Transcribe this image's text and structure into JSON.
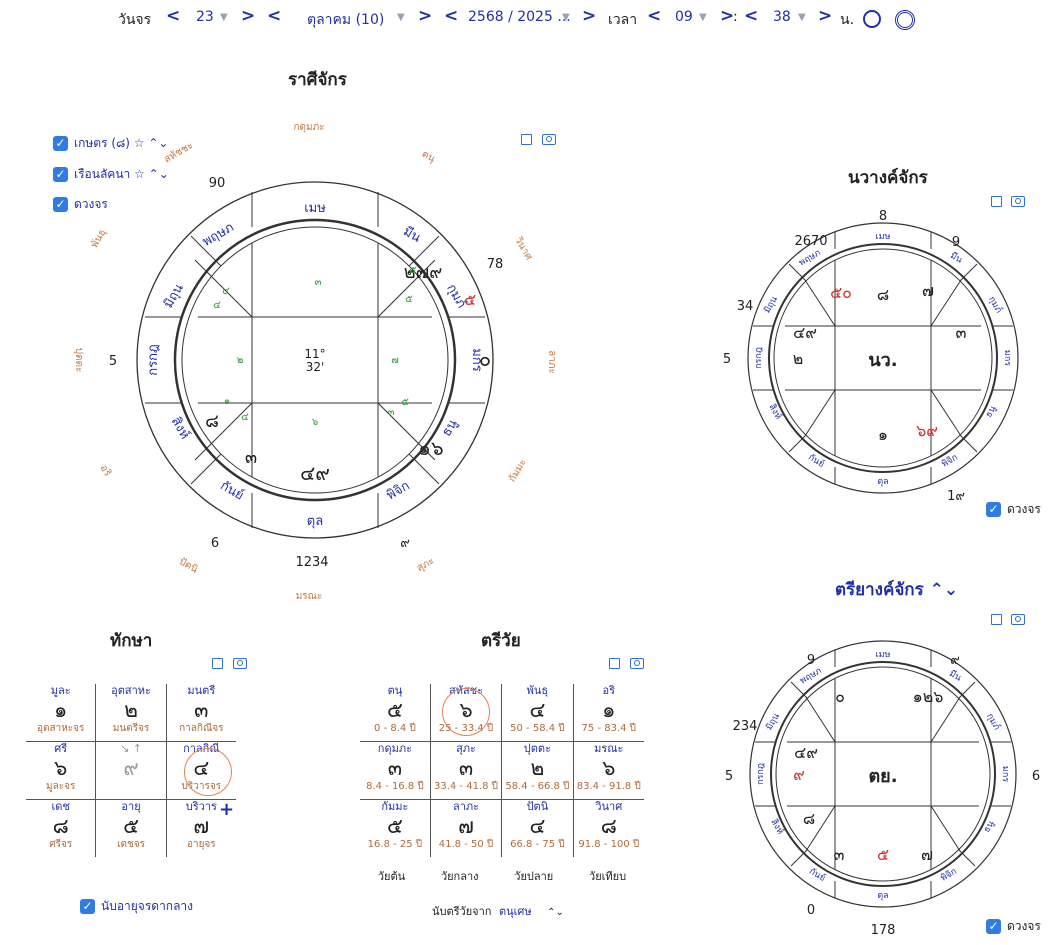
{
  "toolbar": {
    "date_label": "วันจร",
    "prev": "<",
    "next": ">",
    "day": "23",
    "month": "ตุลาคม (10)",
    "year": "2568 / 2025 ...",
    "time_label": "เวลา",
    "hour": "09",
    "colon": ":",
    "minute": "38",
    "unit": "น."
  },
  "rasi": {
    "title": "ราศีจักร",
    "options": [
      "เกษตร (๘) ☆ ⌃⌄",
      "เรือนลัคนา ☆ ⌃⌄",
      "ดวงจร"
    ],
    "center_deg": "11°",
    "center_min": "32'",
    "houses": [
      "เมษ",
      "มีน",
      "กุมภ์",
      "มกร",
      "ธนู",
      "พิจิก",
      "ตุล",
      "กันย์",
      "สิงห์",
      "กรกฎ",
      "มิถุน",
      "พฤษภ"
    ],
    "outer_labels": [
      "กดุมภะ",
      "ตนุ",
      "วินาศ",
      "ลาภะ",
      "กัมมะ",
      "สุภะ",
      "มรณะ",
      "ปัตนิ",
      "อริ",
      "ปุตตะ",
      "พันธุ",
      "สหัชชะ"
    ],
    "transit_numbers": [
      "90",
      "78",
      "5",
      "6",
      "1234",
      "๙"
    ],
    "cell_main": [
      "๒๗๙",
      "๕",
      "๐",
      "๑๖",
      "๔๙",
      "๓",
      "๘"
    ],
    "cell_small": [
      "๓",
      "๕",
      "๕",
      "๔",
      "๒",
      "๗",
      "๑",
      "๔",
      "๖",
      "๓",
      "๕",
      "๔"
    ]
  },
  "navang": {
    "title": "นวางค์จักร",
    "center": "นว.",
    "houses": [
      "เมษ",
      "มีน",
      "กุมภ์",
      "มกร",
      "ธนู",
      "พิจิก",
      "ตุล",
      "กันย์",
      "สิงห์",
      "กรกฎ",
      "มิถุน",
      "พฤษภ"
    ],
    "transit_numbers": [
      "8",
      "9",
      "2670",
      "34",
      "5",
      "1๙"
    ],
    "cell_main": [
      "๘",
      "๗",
      "๓",
      "๕๐",
      "๔๙",
      "๒",
      "๑",
      "๖๙"
    ],
    "checkbox": "ดวงจร"
  },
  "triyang": {
    "title": "ตรียางค์จักร ⌃⌄",
    "center": "ตย.",
    "houses": [
      "เมษ",
      "มีน",
      "กุมภ์",
      "มกร",
      "ธนู",
      "พิจิก",
      "ตุล",
      "กันย์",
      "สิงห์",
      "กรกฎ",
      "มิถุน",
      "พฤษภ"
    ],
    "transit_numbers": [
      "9",
      "๙",
      "234",
      "5",
      "6",
      "0",
      "178"
    ],
    "cell_main": [
      "๐",
      "๑๒๖",
      "๔๙",
      "๙",
      "๘",
      "๓",
      "๕",
      "๗"
    ],
    "checkbox": "ดวงจร"
  },
  "taksa": {
    "title": "ทักษา",
    "rows": [
      [
        {
          "h": "มูละ",
          "d": "๑",
          "s": "อุตสาหะจร"
        },
        {
          "h": "อุตสาหะ",
          "d": "๒",
          "s": "มนตรีจร"
        },
        {
          "h": "มนตรี",
          "d": "๓",
          "s": "กาลกิณีจร"
        }
      ],
      [
        {
          "h": "ศรี",
          "d": "๖",
          "s": "มูละจร"
        },
        {
          "h": "↘ ↑",
          "d": "๙",
          "s": ""
        },
        {
          "h": "กาลกิณี",
          "d": "๔",
          "s": "บริวารจร"
        }
      ],
      [
        {
          "h": "เดช",
          "d": "๘",
          "s": "ศรีจร"
        },
        {
          "h": "อายุ",
          "d": "๕",
          "s": "เดชจร"
        },
        {
          "h": "บริวาร",
          "d": "๗",
          "s": "อายุจร"
        }
      ]
    ],
    "checkbox": "นับอายุจรดากลาง"
  },
  "triwai": {
    "title": "ตรีวัย",
    "rows": [
      [
        {
          "h": "ตนุ",
          "d": "๕",
          "s": "0 - 8.4 ปี"
        },
        {
          "h": "สหัสชะ",
          "d": "๖",
          "s": "25 - 33.4 ปี"
        },
        {
          "h": "พันธุ",
          "d": "๔",
          "s": "50 - 58.4 ปี"
        },
        {
          "h": "อริ",
          "d": "๑",
          "s": "75 - 83.4 ปี"
        }
      ],
      [
        {
          "h": "กดุมภะ",
          "d": "๓",
          "s": "8.4 - 16.8 ปี"
        },
        {
          "h": "สุภะ",
          "d": "๓",
          "s": "33.4 - 41.8 ปี"
        },
        {
          "h": "ปุตตะ",
          "d": "๒",
          "s": "58.4 - 66.8 ปี"
        },
        {
          "h": "มรณะ",
          "d": "๖",
          "s": "83.4 - 91.8 ปี"
        }
      ],
      [
        {
          "h": "กัมมะ",
          "d": "๕",
          "s": "16.8 - 25 ปี"
        },
        {
          "h": "ลาภะ",
          "d": "๗",
          "s": "41.8 - 50 ปี"
        },
        {
          "h": "ปัตนิ",
          "d": "๔",
          "s": "66.8 - 75 ปี"
        },
        {
          "h": "วินาศ",
          "d": "๘",
          "s": "91.8 - 100 ปี"
        }
      ]
    ],
    "footer": [
      "วัยต้น",
      "วัยกลาง",
      "วัยปลาย",
      "วัยเทียบ"
    ],
    "count_label": "นับตรีวัยจาก",
    "count_value": "ตนุเศษ"
  }
}
